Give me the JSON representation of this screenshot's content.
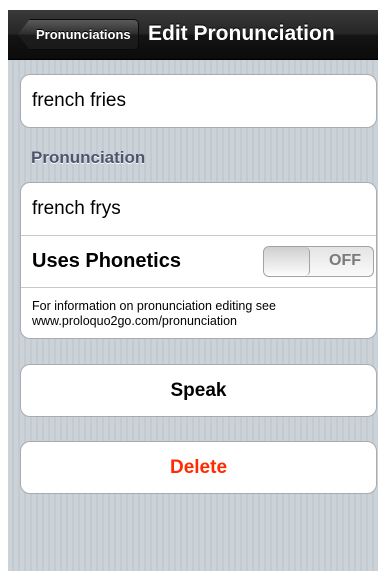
{
  "navbar": {
    "back_label": "Pronunciations",
    "title": "Edit Pronunciation"
  },
  "word": {
    "value": "french fries"
  },
  "pronunciation_section": {
    "header": "Pronunciation",
    "value": "french frys",
    "phonetics_label": "Uses Phonetics",
    "phonetics_toggle_state": "OFF",
    "info_line1": "For information on pronunciation editing see",
    "info_line2": "www.proloquo2go.com/pronunciation"
  },
  "actions": {
    "speak_label": "Speak",
    "delete_label": "Delete"
  },
  "colors": {
    "delete_text": "#ff2a00",
    "section_header": "#4c566c"
  }
}
